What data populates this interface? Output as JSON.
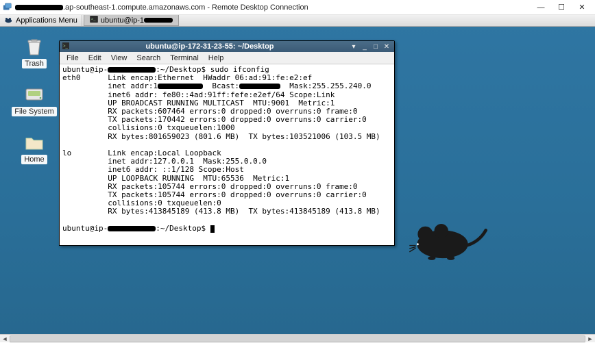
{
  "rdp": {
    "host_suffix": ".ap-southeast-1.compute.amazonaws.com - Remote Desktop Connection",
    "min": "—",
    "max": "☐",
    "close": "✕"
  },
  "panel": {
    "apps_label": "Applications Menu",
    "task_label": "ubuntu@ip-1"
  },
  "desktop_icons": {
    "trash": "Trash",
    "filesystem": "File System",
    "home": "Home"
  },
  "term": {
    "title": "ubuntu@ip-172-31-23-55: ~/Desktop",
    "win_pin": "▾",
    "win_min": "_",
    "win_max": "□",
    "win_close": "✕",
    "menu": {
      "file": "File",
      "edit": "Edit",
      "view": "View",
      "search": "Search",
      "terminal": "Terminal",
      "help": "Help"
    },
    "line_prompt1_a": "ubuntu@ip-",
    "line_prompt1_b": ":~/Desktop$ sudo ifconfig",
    "eth0_l1_a": "eth0      Link encap:Ethernet  HWaddr 06:ad:91:fe:e2:ef",
    "eth0_l2_a": "          inet addr:1",
    "eth0_l2_b": "  Bcast:",
    "eth0_l2_c": "  Mask:255.255.240.0",
    "eth0_l3": "          inet6 addr: fe80::4ad:91ff:fefe:e2ef/64 Scope:Link",
    "eth0_l4": "          UP BROADCAST RUNNING MULTICAST  MTU:9001  Metric:1",
    "eth0_l5": "          RX packets:607464 errors:0 dropped:0 overruns:0 frame:0",
    "eth0_l6": "          TX packets:170442 errors:0 dropped:0 overruns:0 carrier:0",
    "eth0_l7": "          collisions:0 txqueuelen:1000",
    "eth0_l8": "          RX bytes:801659023 (801.6 MB)  TX bytes:103521006 (103.5 MB)",
    "blank": "",
    "lo_l1": "lo        Link encap:Local Loopback",
    "lo_l2": "          inet addr:127.0.0.1  Mask:255.0.0.0",
    "lo_l3": "          inet6 addr: ::1/128 Scope:Host",
    "lo_l4": "          UP LOOPBACK RUNNING  MTU:65536  Metric:1",
    "lo_l5": "          RX packets:105744 errors:0 dropped:0 overruns:0 frame:0",
    "lo_l6": "          TX packets:105744 errors:0 dropped:0 overruns:0 carrier:0",
    "lo_l7": "          collisions:0 txqueuelen:0",
    "lo_l8": "          RX bytes:413845189 (413.8 MB)  TX bytes:413845189 (413.8 MB)",
    "line_prompt2_a": "ubuntu@ip-",
    "line_prompt2_b": ":~/Desktop$ "
  }
}
